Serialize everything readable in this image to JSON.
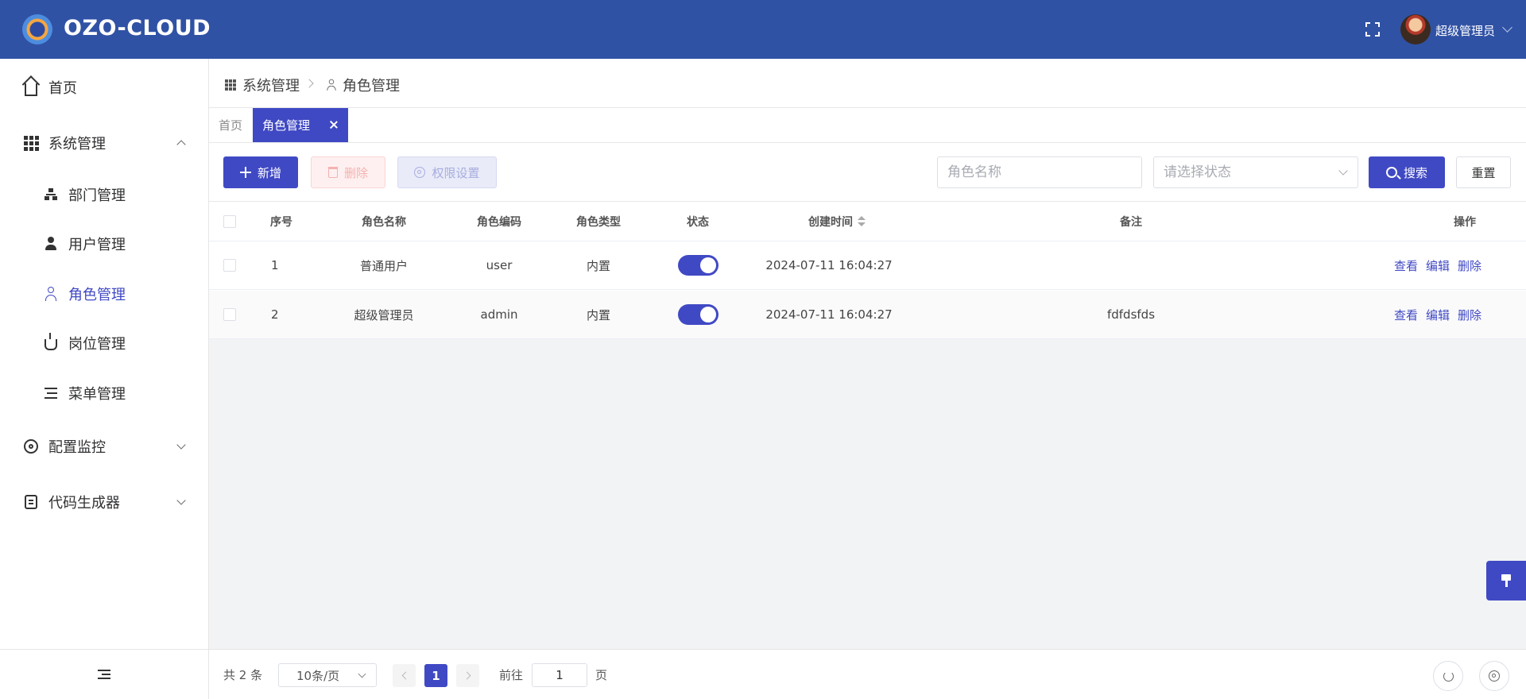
{
  "header": {
    "brand": "OZO-CLOUD",
    "username": "超级管理员"
  },
  "sidebar": {
    "items": [
      {
        "label": "首页",
        "icon": "home-icon"
      },
      {
        "label": "系统管理",
        "icon": "grid-icon",
        "expanded": true
      },
      {
        "label": "部门管理",
        "icon": "org-icon"
      },
      {
        "label": "用户管理",
        "icon": "user-icon"
      },
      {
        "label": "角色管理",
        "icon": "user-outline-icon",
        "active": true
      },
      {
        "label": "岗位管理",
        "icon": "post-icon"
      },
      {
        "label": "菜单管理",
        "icon": "menu-icon"
      },
      {
        "label": "配置监控",
        "icon": "gear-icon",
        "expanded": false
      },
      {
        "label": "代码生成器",
        "icon": "code-icon",
        "expanded": false
      }
    ]
  },
  "breadcrumb": {
    "parent": "系统管理",
    "current": "角色管理"
  },
  "tabs": {
    "home": "首页",
    "active": "角色管理"
  },
  "toolbar": {
    "add": "新增",
    "delete": "删除",
    "permissions": "权限设置",
    "name_placeholder": "角色名称",
    "status_placeholder": "请选择状态",
    "search": "搜索",
    "reset": "重置"
  },
  "table": {
    "columns": [
      "序号",
      "角色名称",
      "角色编码",
      "角色类型",
      "状态",
      "创建时间",
      "备注",
      "操作"
    ],
    "rows": [
      {
        "index": "1",
        "name": "普通用户",
        "code": "user",
        "type": "内置",
        "enabled": true,
        "created": "2024-07-11 16:04:27",
        "remark": ""
      },
      {
        "index": "2",
        "name": "超级管理员",
        "code": "admin",
        "type": "内置",
        "enabled": true,
        "created": "2024-07-11 16:04:27",
        "remark": "fdfdsfds"
      }
    ],
    "actions": {
      "view": "查看",
      "edit": "编辑",
      "delete": "删除"
    }
  },
  "pagination": {
    "total": "共 2 条",
    "page_size": "10条/页",
    "current_page": "1",
    "goto_label": "前往",
    "goto_value": "1",
    "page_suffix": "页"
  },
  "colors": {
    "header": "#3052a5",
    "accent": "#4049c4"
  }
}
